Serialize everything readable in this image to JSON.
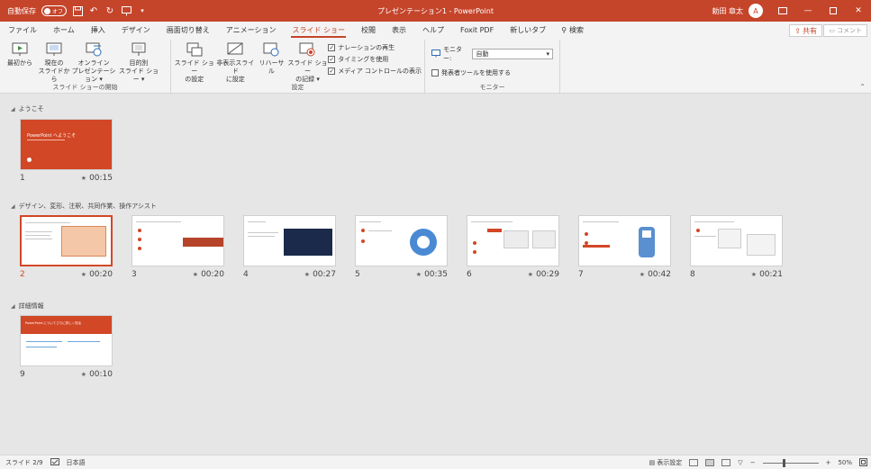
{
  "titlebar": {
    "autosave_label": "自動保存",
    "autosave_state": "オフ",
    "title": "プレゼンテーション1 - PowerPoint",
    "user_name": "勅田 章太",
    "user_initial": "A",
    "accent": "#c5452b"
  },
  "tabs": [
    {
      "label": "ファイル"
    },
    {
      "label": "ホーム"
    },
    {
      "label": "挿入"
    },
    {
      "label": "デザイン"
    },
    {
      "label": "画面切り替え"
    },
    {
      "label": "アニメーション"
    },
    {
      "label": "スライド ショー",
      "active": true
    },
    {
      "label": "校閲"
    },
    {
      "label": "表示"
    },
    {
      "label": "ヘルプ"
    },
    {
      "label": "Foxit PDF"
    },
    {
      "label": "新しいタブ"
    }
  ],
  "search_label": "検索",
  "share_label": "共有",
  "comment_label": "コメント",
  "ribbon": {
    "start_group": {
      "label": "スライド ショーの開始",
      "buttons": [
        "最初から",
        "現在の\nスライドから",
        "オンライン\nプレゼンテーション ▾",
        "目的別\nスライド ショー ▾"
      ]
    },
    "setup_group": {
      "label": "設定",
      "buttons": [
        "スライド ショー\nの設定",
        "非表示スライド\nに設定",
        "リハーサル",
        "スライド ショー\nの記録 ▾"
      ],
      "checks": [
        {
          "label": "ナレーションの再生",
          "checked": true
        },
        {
          "label": "タイミングを使用",
          "checked": true
        },
        {
          "label": "メディア コントロールの表示",
          "checked": true
        }
      ]
    },
    "monitor_group": {
      "label": "モニター",
      "monitor_label": "モニター:",
      "monitor_value": "自動",
      "presenter_label": "発表者ツールを使用する",
      "presenter_checked": false
    }
  },
  "sections": [
    {
      "name": "ようこそ"
    },
    {
      "name": "デザイン、変形、注釈、共同作業、操作アシスト"
    },
    {
      "name": "詳細情報"
    }
  ],
  "slides": [
    {
      "num": "1",
      "dur": "00:15",
      "thumb_title": "PowerPoint へようこそ"
    },
    {
      "num": "2",
      "dur": "00:20",
      "thumb_title": "デザインの設定が簡単"
    },
    {
      "num": "3",
      "dur": "00:20",
      "thumb_title": ""
    },
    {
      "num": "4",
      "dur": "00:27",
      "thumb_title": ""
    },
    {
      "num": "5",
      "dur": "00:35",
      "thumb_title": ""
    },
    {
      "num": "6",
      "dur": "00:29",
      "thumb_title": ""
    },
    {
      "num": "7",
      "dur": "00:42",
      "thumb_title": ""
    },
    {
      "num": "8",
      "dur": "00:21",
      "thumb_title": ""
    },
    {
      "num": "9",
      "dur": "00:10",
      "thumb_title": "PowerPoint についてさらに詳しく知る"
    }
  ],
  "statusbar": {
    "slide_pos": "スライド 2/9",
    "language": "日本語",
    "display_settings": "表示設定",
    "zoom": "50%"
  }
}
